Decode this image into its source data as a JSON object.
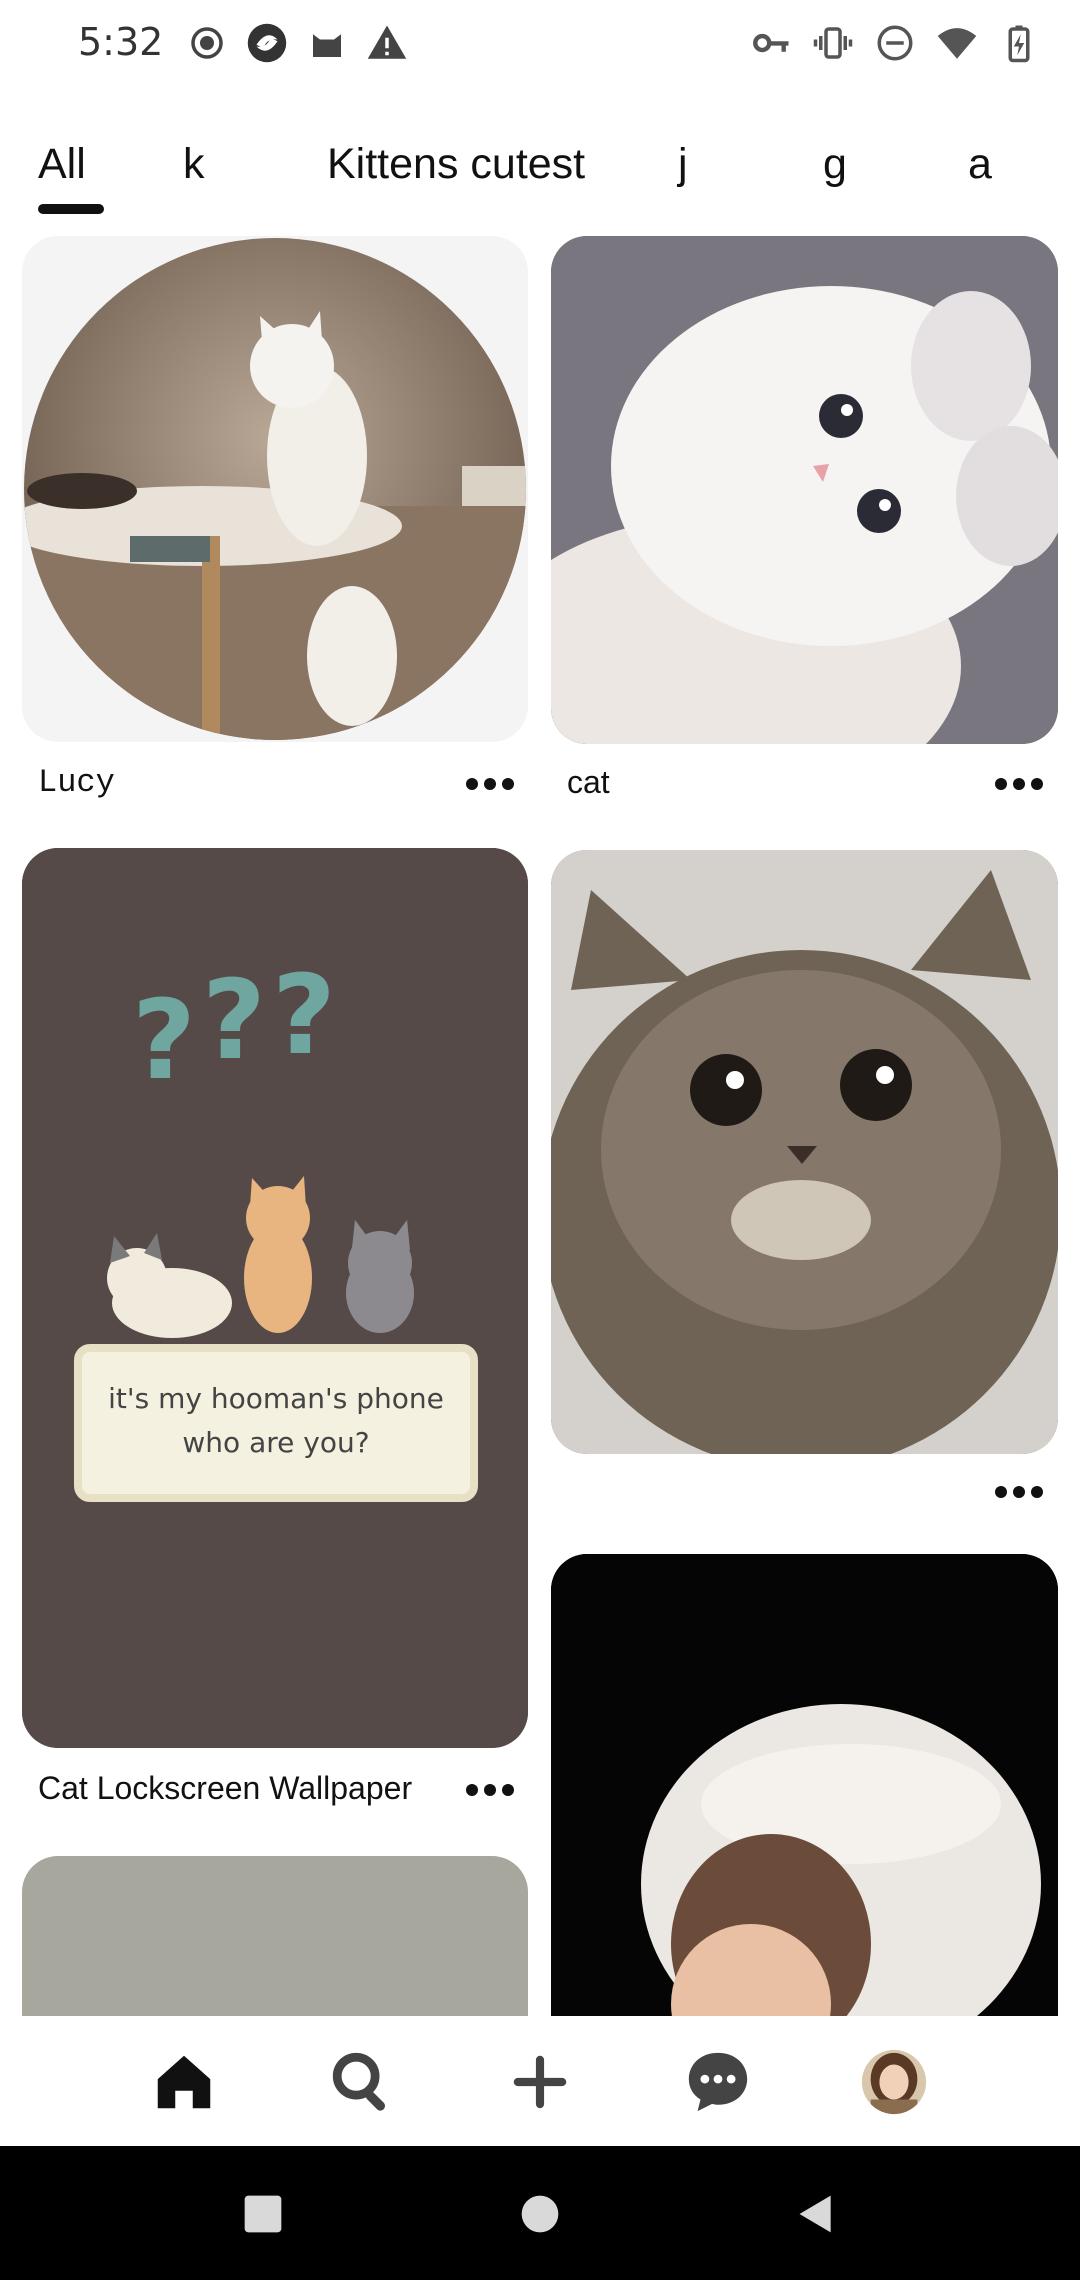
{
  "status_bar": {
    "time": "5:32",
    "left_icons": [
      "record-icon",
      "app-swirl-icon",
      "cat-app-icon",
      "warning-icon"
    ],
    "right_icons": [
      "vpn-key-icon",
      "vibrate-icon",
      "dnd-icon",
      "wifi-icon",
      "battery-charging-icon"
    ]
  },
  "tabs": [
    {
      "label": "All",
      "selected": true
    },
    {
      "label": "k",
      "selected": false
    },
    {
      "label": "Kittens cutest",
      "selected": false
    },
    {
      "label": "j",
      "selected": false
    },
    {
      "label": "g",
      "selected": false
    },
    {
      "label": "a",
      "selected": false
    }
  ],
  "pins": [
    {
      "title": "Lucy",
      "image": "white cat sitting on table (circular)"
    },
    {
      "title": "cat",
      "image": "white fluffy kitten looking up"
    },
    {
      "title": "Cat Lockscreen Wallpaper",
      "image": "cartoon cats with question marks",
      "caption_line1": "it's my hooman's phone",
      "caption_line2": "who are you?"
    },
    {
      "title": "",
      "image": "tabby kitten closeup"
    },
    {
      "title": "",
      "image": "person with white fur hood"
    },
    {
      "title": "",
      "image": "textured grey wall"
    }
  ],
  "bottom_nav": [
    "home-icon",
    "search-icon",
    "add-icon",
    "messages-icon",
    "profile-avatar"
  ],
  "system_nav": [
    "recents-button",
    "home-button",
    "back-button"
  ],
  "colors": {
    "accent": "#111111",
    "wallpaper_bg": "#554a48",
    "card_bg": "#f4f1e0"
  }
}
